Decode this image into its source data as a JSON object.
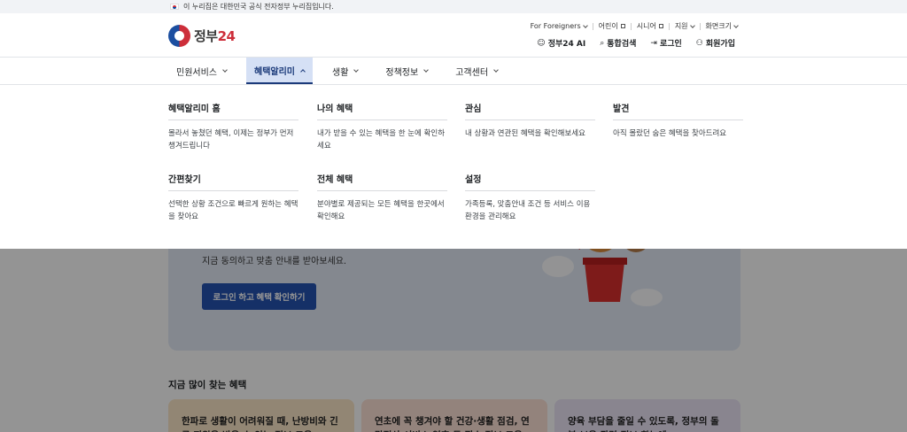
{
  "banner": {
    "text": "이 누리집은 대한민국 공식 전자정부 누리집입니다."
  },
  "logo": {
    "text": "정부",
    "num": "24"
  },
  "util_top": [
    {
      "label": "For Foreigners",
      "kind": "chevron"
    },
    {
      "label": "어린이",
      "kind": "external"
    },
    {
      "label": "시니어",
      "kind": "external"
    },
    {
      "label": "지원",
      "kind": "chevron"
    },
    {
      "label": "화면크기",
      "kind": "chevron"
    }
  ],
  "util_bottom": [
    {
      "label": "정부24 AI",
      "icon": "ai-icon",
      "glyph": "☺"
    },
    {
      "label": "통합검색",
      "icon": "search-icon",
      "glyph": "⌕"
    },
    {
      "label": "로그인",
      "icon": "login-icon",
      "glyph": "⇥"
    },
    {
      "label": "회원가입",
      "icon": "user-add-icon",
      "glyph": "⚇"
    }
  ],
  "nav": [
    {
      "label": "민원서비스",
      "active": false
    },
    {
      "label": "혜택알리미",
      "active": true
    },
    {
      "label": "생활",
      "active": false
    },
    {
      "label": "정책정보",
      "active": false
    },
    {
      "label": "고객센터",
      "active": false
    }
  ],
  "mega_menu": [
    {
      "title": "혜택알리미 홈",
      "desc": "몰라서 놓쳤던 혜택, 이제는 정부가 먼저 챙겨드립니다"
    },
    {
      "title": "나의 혜택",
      "desc": "내가 받을 수 있는 혜택을 한 눈에 확인하세요"
    },
    {
      "title": "관심",
      "desc": "내 상황과 연관된 혜택을 확인해보세요"
    },
    {
      "title": "발견",
      "desc": "아직 몰랐던 숨은 혜택을 찾아드려요"
    },
    {
      "title": "간편찾기",
      "desc": "선택한 상황 조건으로 빠르게 원하는 혜택을 찾아요"
    },
    {
      "title": "전체 혜택",
      "desc": "분야별로 제공되는 모든 혜택을 한곳에서 확인해요"
    },
    {
      "title": "설정",
      "desc": "가족등록, 맞춤안내 조건 등 서비스 이용 환경을 관리해요"
    }
  ],
  "hero": {
    "subtitle": "지금 동의하고 맞춤 안내를 받아보세요.",
    "button": "로그인 하고 혜택 확인하기"
  },
  "popular": {
    "title": "지금 많이 찾는 혜택",
    "cards": [
      "한파로 생활이 어려워질 때, 난방비와 긴급 지원을 받을 수 있는 정보 모음",
      "연초에 꼭 챙겨야 할 건강·생활 점검, 연말정산 서비스 연휴 등 필수 정보 모음",
      "양육 부담을 줄일 수 있도록, 정부의 돌봄·보육 관련 정보 한눈에"
    ]
  },
  "colors": {
    "accent": "#1b3a7a",
    "button": "#2553b2",
    "nav_active_bg": "#d5e0f5"
  }
}
